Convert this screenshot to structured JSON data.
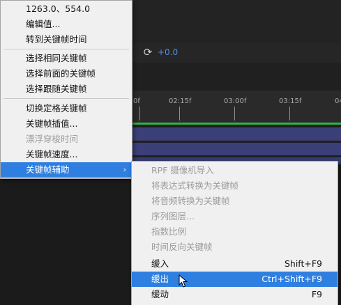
{
  "background": {
    "toolbar_value": "+0.0",
    "ruler_labels": [
      "0f",
      "02:15f",
      "03:00f",
      "03:15f",
      "04"
    ]
  },
  "main_menu": {
    "items": [
      {
        "label": "1263.0、554.0",
        "disabled": false
      },
      {
        "label": "编辑值...",
        "disabled": false
      },
      {
        "label": "转到关键帧时间",
        "disabled": false
      },
      {
        "label": "选择相同关键帧",
        "disabled": false
      },
      {
        "label": "选择前面的关键帧",
        "disabled": false
      },
      {
        "label": "选择跟随关键帧",
        "disabled": false
      },
      {
        "label": "切换定格关键帧",
        "disabled": false
      },
      {
        "label": "关键帧插值...",
        "disabled": false
      },
      {
        "label": "漂浮穿梭时间",
        "disabled": true
      },
      {
        "label": "关键帧速度...",
        "disabled": false
      },
      {
        "label": "关键帧辅助",
        "disabled": false,
        "highlighted": true,
        "submenu_arrow": "›"
      }
    ]
  },
  "sub_menu": {
    "items": [
      {
        "label": "RPF 摄像机导入",
        "shortcut": "",
        "disabled": true
      },
      {
        "label": "将表达式转换为关键帧",
        "shortcut": "",
        "disabled": true
      },
      {
        "label": "将音频转换为关键帧",
        "shortcut": "",
        "disabled": true
      },
      {
        "label": "序列图层...",
        "shortcut": "",
        "disabled": true
      },
      {
        "label": "指数比例",
        "shortcut": "",
        "disabled": true
      },
      {
        "label": "时间反向关键帧",
        "shortcut": "",
        "disabled": true
      },
      {
        "label": "缓入",
        "shortcut": "Shift+F9",
        "disabled": false
      },
      {
        "label": "缓出",
        "shortcut": "Ctrl+Shift+F9",
        "disabled": false,
        "highlighted": true
      },
      {
        "label": "缓动",
        "shortcut": "F9",
        "disabled": false
      }
    ]
  },
  "colors": {
    "menu_bg": "#f0f0f0",
    "highlight": "#2f7fe0",
    "disabled_text": "#9b9b9b",
    "keyframe_strip": "#3b3f78",
    "timeline_green": "#2fb34b",
    "toolbar_value": "#4f8fea"
  },
  "icons": {
    "toolbar_icon": "refresh-icon",
    "cursor": "mouse-pointer-icon"
  }
}
